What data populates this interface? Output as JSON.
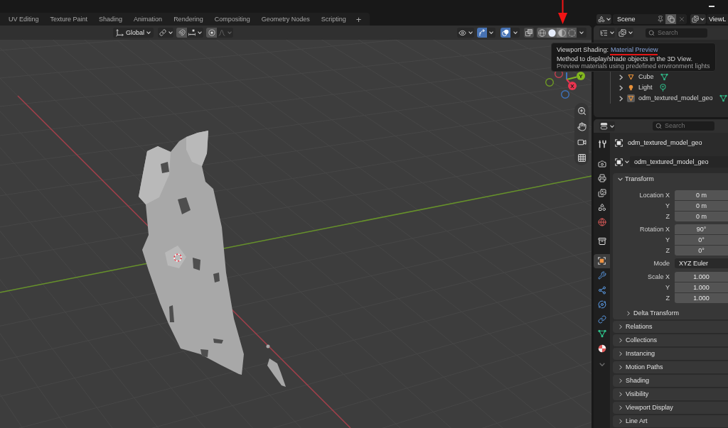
{
  "top_bar": {
    "workspace_tabs": [
      {
        "label": "UV Editing",
        "selected": false
      },
      {
        "label": "Texture Paint",
        "selected": false
      },
      {
        "label": "Shading",
        "selected": false
      },
      {
        "label": "Animation",
        "selected": false
      },
      {
        "label": "Rendering",
        "selected": false
      },
      {
        "label": "Compositing",
        "selected": false
      },
      {
        "label": "Geometry Nodes",
        "selected": false
      },
      {
        "label": "Scripting",
        "selected": false
      }
    ],
    "add_tab": "+",
    "scene": "Scene",
    "view_layer": "ViewL"
  },
  "viewport_header": {
    "orientation": "Global",
    "gizmos_on": true,
    "overlays_on": true,
    "shading_modes": [
      {
        "kind": "wireframe",
        "selected": false,
        "hovered": false
      },
      {
        "kind": "solid",
        "selected": true,
        "hovered": false
      },
      {
        "kind": "material",
        "selected": false,
        "hovered": true
      },
      {
        "kind": "rendered",
        "selected": false,
        "hovered": false
      }
    ]
  },
  "gizmo": {
    "axes": [
      {
        "label": "Y",
        "color": "#82b71f"
      },
      {
        "label": "X",
        "color": "#e8344f"
      }
    ],
    "negative_axes": [
      {
        "color": "#c8404f"
      },
      {
        "color": "#6f9b24"
      },
      {
        "color": "#3e73bd"
      }
    ]
  },
  "tooltip": {
    "label": "Viewport Shading:",
    "value": "Material Preview",
    "description": "Method to display/shade objects in the 3D View.",
    "hint": "Preview materials using predefined environment lights"
  },
  "outliner": {
    "search_placeholder": "Search",
    "rows": [
      {
        "name": "Cube",
        "kind": "mesh",
        "expanded": false,
        "active": false
      },
      {
        "name": "Light",
        "kind": "light",
        "expanded": false,
        "active": false
      },
      {
        "name": "odm_textured_model_geo",
        "kind": "mesh",
        "expanded": false,
        "active": true
      }
    ]
  },
  "properties": {
    "search_placeholder": "Search",
    "tab_groups": [
      {
        "tabs": [
          {
            "kind": "tool",
            "selected": false
          }
        ]
      },
      {
        "tabs": [
          {
            "kind": "render",
            "selected": false
          },
          {
            "kind": "output",
            "selected": false
          },
          {
            "kind": "view_layer",
            "selected": false
          },
          {
            "kind": "scene",
            "selected": false
          },
          {
            "kind": "world",
            "selected": false
          }
        ]
      },
      {
        "tabs": [
          {
            "kind": "collection",
            "selected": false
          }
        ]
      },
      {
        "tabs": [
          {
            "kind": "object",
            "selected": true
          },
          {
            "kind": "modifiers",
            "selected": false
          },
          {
            "kind": "particles",
            "selected": false
          },
          {
            "kind": "physics",
            "selected": false
          },
          {
            "kind": "constraints",
            "selected": false
          },
          {
            "kind": "data",
            "selected": false
          },
          {
            "kind": "material",
            "selected": false
          }
        ]
      }
    ],
    "object_name": "odm_textured_model_geo",
    "datablock": "odm_textured_model_geo",
    "panels": [
      {
        "title": "Transform",
        "expanded": true,
        "groups": [
          {
            "kind": "number",
            "rows": [
              {
                "label": "Location X",
                "value": "0 m"
              },
              {
                "label": "Y",
                "value": "0 m"
              },
              {
                "label": "Z",
                "value": "0 m"
              }
            ]
          },
          {
            "kind": "number",
            "rows": [
              {
                "label": "Rotation X",
                "value": "90°"
              },
              {
                "label": "Y",
                "value": "0°"
              },
              {
                "label": "Z",
                "value": "0°"
              }
            ]
          },
          {
            "kind": "dropdown",
            "rows": [
              {
                "label": "Mode",
                "value": "XYZ Euler"
              }
            ]
          },
          {
            "kind": "number",
            "rows": [
              {
                "label": "Scale X",
                "value": "1.000"
              },
              {
                "label": "Y",
                "value": "1.000"
              },
              {
                "label": "Z",
                "value": "1.000"
              }
            ]
          }
        ],
        "subpanels": [
          {
            "title": "Delta Transform",
            "expanded": false
          }
        ]
      },
      {
        "title": "Relations",
        "expanded": false
      },
      {
        "title": "Collections",
        "expanded": false
      },
      {
        "title": "Instancing",
        "expanded": false
      },
      {
        "title": "Motion Paths",
        "expanded": false
      },
      {
        "title": "Shading",
        "expanded": false
      },
      {
        "title": "Visibility",
        "expanded": false
      },
      {
        "title": "Viewport Display",
        "expanded": false
      },
      {
        "title": "Line Art",
        "expanded": false
      }
    ]
  }
}
